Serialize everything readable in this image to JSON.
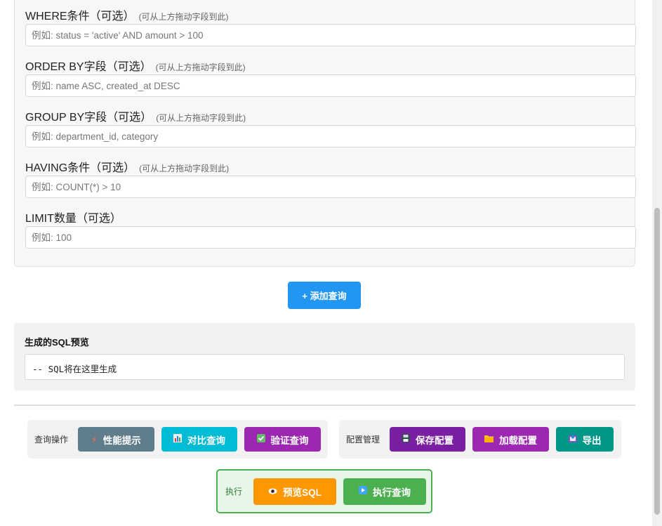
{
  "fields": [
    {
      "label": "WHERE条件（可选）",
      "hint": "(可从上方拖动字段到此)",
      "placeholder": "例如: status = 'active' AND amount > 100"
    },
    {
      "label": "ORDER BY字段（可选）",
      "hint": "(可从上方拖动字段到此)",
      "placeholder": "例如: name ASC, created_at DESC"
    },
    {
      "label": "GROUP BY字段（可选）",
      "hint": "(可从上方拖动字段到此)",
      "placeholder": "例如: department_id, category"
    },
    {
      "label": "HAVING条件（可选）",
      "hint": "(可从上方拖动字段到此)",
      "placeholder": "例如: COUNT(*) > 10"
    },
    {
      "label": "LIMIT数量（可选）",
      "placeholder": "例如: 100"
    }
  ],
  "add_query_label": "+ 添加查询",
  "preview": {
    "title": "生成的SQL预览",
    "sql": "-- SQL将在这里生成"
  },
  "query_ops": {
    "label": "查询操作",
    "buttons": [
      {
        "label": "性能提示",
        "icon": "lightning-icon",
        "color": "#607d8b"
      },
      {
        "label": "对比查询",
        "icon": "bar-chart-icon",
        "color": "#00bcd4"
      },
      {
        "label": "验证查询",
        "icon": "check-box-icon",
        "color": "#9c27b0"
      }
    ]
  },
  "config_mgmt": {
    "label": "配置管理",
    "buttons": [
      {
        "label": "保存配置",
        "icon": "floppy-disk-icon",
        "color": "#7b1fa2"
      },
      {
        "label": "加载配置",
        "icon": "folder-icon",
        "color": "#9c27b0"
      },
      {
        "label": "导出",
        "icon": "export-icon",
        "color": "#009688"
      }
    ]
  },
  "execute": {
    "label": "执行",
    "buttons": [
      {
        "label": "预览SQL",
        "icon": "eye-icon",
        "color": "#ff9800"
      },
      {
        "label": "执行查询",
        "icon": "play-icon",
        "color": "#4caf50"
      }
    ]
  }
}
